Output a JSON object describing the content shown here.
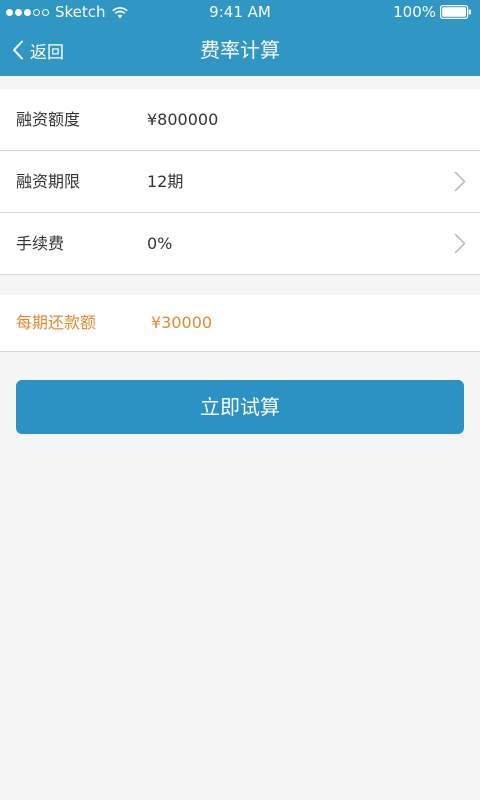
{
  "status_bar": {
    "carrier": "Sketch",
    "signal_full": 3,
    "signal_empty": 2,
    "time": "9:41 AM",
    "battery_text": "100%",
    "battery_level": 1.0,
    "wifi_icon": "wifi-icon",
    "battery_icon": "battery-icon"
  },
  "nav": {
    "back_label": "返回",
    "back_icon": "chevron-left-icon",
    "title": "费率计算"
  },
  "form": {
    "rows": [
      {
        "label": "融资额度",
        "value": "¥800000",
        "has_arrow": false
      },
      {
        "label": "融资期限",
        "value": "12期",
        "has_arrow": true
      },
      {
        "label": "手续费",
        "value": "0%",
        "has_arrow": true
      }
    ]
  },
  "result": {
    "label": "每期还款额",
    "value": "¥30000"
  },
  "calc_button": {
    "label": "立即试算"
  },
  "colors": {
    "primary": "#3097c4",
    "button": "#2b92c3",
    "accent_orange": "#e08a35",
    "background": "#f5f5f5"
  }
}
